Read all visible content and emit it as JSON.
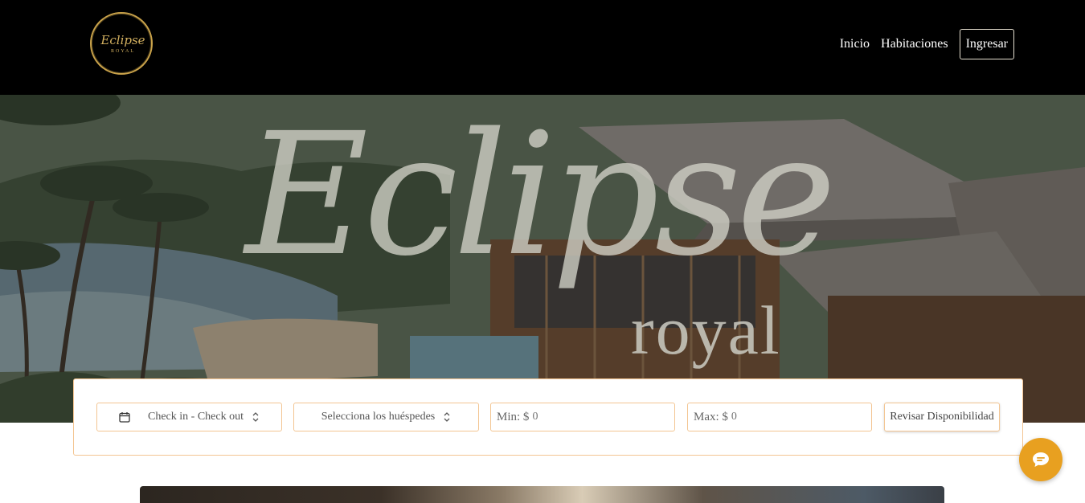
{
  "header": {
    "logo": {
      "text": "Eclipse",
      "sub": "ROYAL"
    },
    "nav": [
      {
        "label": "Inicio"
      },
      {
        "label": "Habitaciones"
      }
    ],
    "login_label": "Ingresar"
  },
  "hero": {
    "title": "Eclipse",
    "subtitle": "royal"
  },
  "search": {
    "dates_label": "Check in - Check out",
    "guests_label": "Selecciona los huéspedes",
    "min_prefix": "Min: $",
    "min_placeholder": "0",
    "max_prefix": "Max: $",
    "max_placeholder": "0",
    "submit_label": "Revisar Disponibilidad"
  },
  "colors": {
    "accent": "#f3c592",
    "gold": "#c9a24a",
    "chat": "#e8a020"
  },
  "icons": [
    "calendar-icon",
    "chevron-updown-icon",
    "chat-icon"
  ]
}
